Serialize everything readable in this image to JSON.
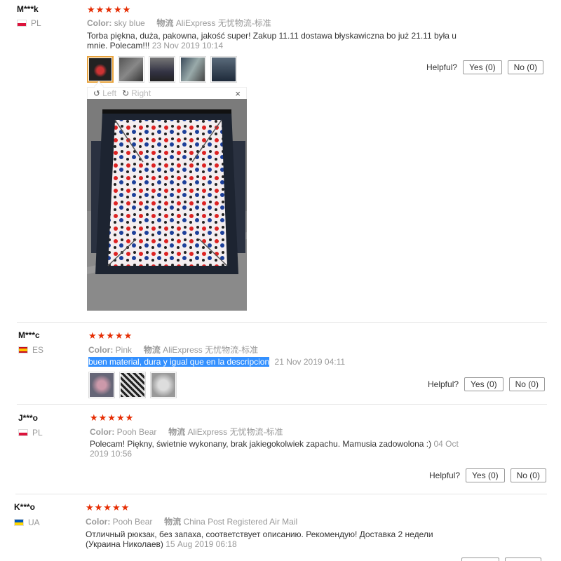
{
  "reviews": [
    {
      "name": "M***k",
      "country": "PL",
      "stars": "★★★★★",
      "color_label": "Color:",
      "color_value": "sky blue",
      "shipping_label": "物流",
      "shipping_value": "AliExpress 无忧物流-标准",
      "text_line1": "Torba piękna, duża, pakowna, jakość super! Zakup 11.11 dostawa błyskawiczna bo już 21.11 była u",
      "text_line2": "mnie. Polecam!!!",
      "date": "23 Nov 2019 10:14",
      "helpful_label": "Helpful?",
      "yes_label": "Yes (0)",
      "no_label": "No (0)"
    },
    {
      "name": "M***c",
      "country": "ES",
      "stars": "★★★★★",
      "color_label": "Color:",
      "color_value": "Pink",
      "shipping_label": "物流",
      "shipping_value": "AliExpress 无忧物流-标准",
      "text_line1": "buen material, dura y igual que en la descripcion",
      "date": "21 Nov 2019 04:11",
      "helpful_label": "Helpful?",
      "yes_label": "Yes (0)",
      "no_label": "No (0)"
    },
    {
      "name": "J***o",
      "country": "PL",
      "stars": "★★★★★",
      "color_label": "Color:",
      "color_value": "Pooh Bear",
      "shipping_label": "物流",
      "shipping_value": "AliExpress 无忧物流-标准",
      "text_line1": "Polecam! Piękny, świetnie wykonany, brak jakiegokolwiek zapachu. Mamusia zadowolona :)",
      "date_part1": "04 Oct",
      "date_part2": "2019 10:56",
      "helpful_label": "Helpful?",
      "yes_label": "Yes (0)",
      "no_label": "No (0)"
    },
    {
      "name": "K***o",
      "country": "UA",
      "stars": "★★★★★",
      "color_label": "Color:",
      "color_value": "Pooh Bear",
      "shipping_label": "物流",
      "shipping_value": "China Post Registered Air Mail",
      "text_line1": "Отличный рюкзак, без запаха, соответствует описанию. Рекомендую! Доставка 2 недели",
      "text_line2": "(Украина Николаев)",
      "date": "15 Aug 2019 06:18"
    }
  ],
  "viewer": {
    "left_label": "Left",
    "right_label": "Right",
    "close_glyph": "×"
  },
  "colors": {
    "star": "#e62e04",
    "highlight": "#3390ff",
    "active_thumb_border": "#e8a33e"
  }
}
